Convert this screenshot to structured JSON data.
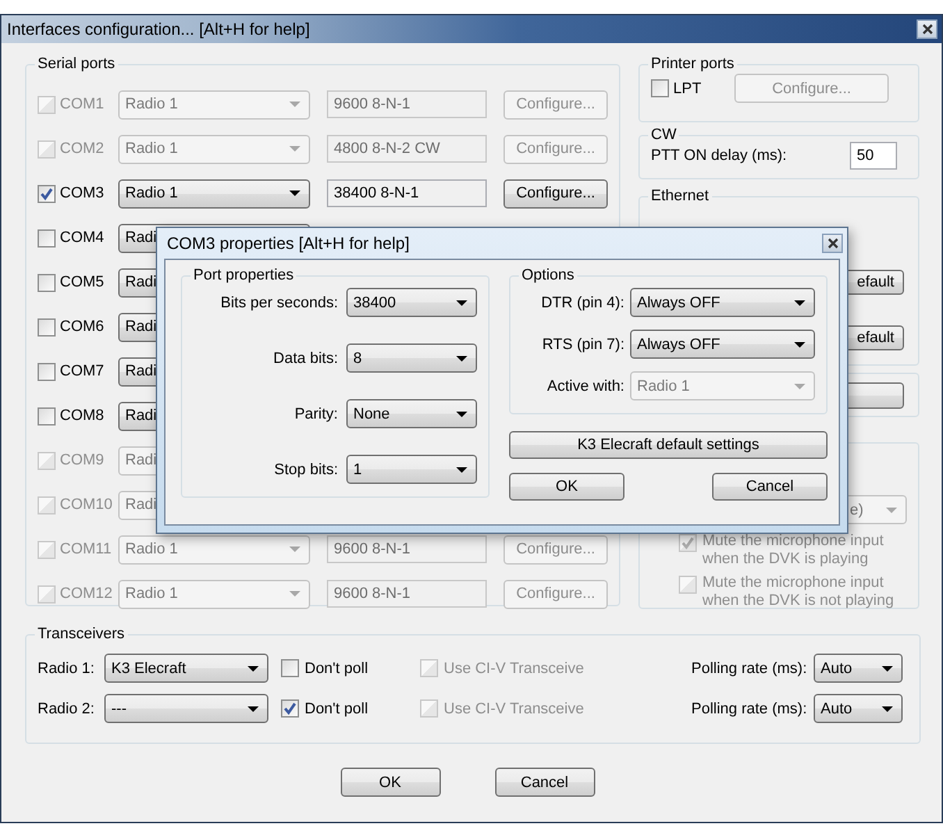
{
  "window": {
    "title": "Interfaces configuration... [Alt+H for help]"
  },
  "serial_ports": {
    "title": "Serial ports",
    "ports": [
      {
        "label": "COM1",
        "checked": false,
        "disabled": true,
        "radio": "Radio 1",
        "settings": "9600 8-N-1",
        "button": "Configure..."
      },
      {
        "label": "COM2",
        "checked": false,
        "disabled": true,
        "radio": "Radio 1",
        "settings": "4800 8-N-2 CW",
        "button": "Configure..."
      },
      {
        "label": "COM3",
        "checked": true,
        "disabled": false,
        "radio": "Radio 1",
        "settings": "38400 8-N-1",
        "button": "Configure..."
      },
      {
        "label": "COM4",
        "checked": false,
        "disabled": false,
        "radio": "Radi"
      },
      {
        "label": "COM5",
        "checked": false,
        "disabled": false,
        "radio": "Radi"
      },
      {
        "label": "COM6",
        "checked": false,
        "disabled": false,
        "radio": "Radi"
      },
      {
        "label": "COM7",
        "checked": false,
        "disabled": false,
        "radio": "Radi"
      },
      {
        "label": "COM8",
        "checked": false,
        "disabled": false,
        "radio": "Radi"
      },
      {
        "label": "COM9",
        "checked": false,
        "disabled": true,
        "radio": "Radi"
      },
      {
        "label": "COM10",
        "checked": false,
        "disabled": true,
        "radio": "Radi"
      },
      {
        "label": "COM11",
        "checked": false,
        "disabled": true,
        "radio": "Radio 1",
        "settings": "9600 8-N-1",
        "button": "Configure..."
      },
      {
        "label": "COM12",
        "checked": false,
        "disabled": true,
        "radio": "Radio 1",
        "settings": "9600 8-N-1",
        "button": "Configure..."
      }
    ]
  },
  "printer_ports": {
    "title": "Printer ports",
    "lpt": {
      "label": "LPT",
      "checked": false
    },
    "configure": {
      "label": "Configure...",
      "disabled": true
    }
  },
  "cw": {
    "title": "CW",
    "label": "PTT ON delay (ms):",
    "value": "50"
  },
  "ethernet": {
    "title": "Ethernet",
    "buttons": [
      "efault",
      "efault"
    ]
  },
  "dvk": {
    "dropdown": {
      "value": "e)",
      "disabled": true
    },
    "checkboxes": [
      {
        "label": "Mute the microphone input when the DVK is playing",
        "checked": true,
        "disabled": true
      },
      {
        "label": "Mute the microphone input when the DVK is not playing",
        "checked": false,
        "disabled": true
      }
    ]
  },
  "transceivers": {
    "title": "Transceivers",
    "radios": [
      {
        "label": "Radio 1:",
        "value": "K3 Elecraft",
        "dont_poll": {
          "label": "Don't poll",
          "checked": false
        },
        "civ": {
          "label": "Use CI-V Transceive",
          "checked": false,
          "disabled": true
        },
        "polling_label": "Polling rate (ms):",
        "polling": "Auto"
      },
      {
        "label": "Radio 2:",
        "value": "---",
        "dont_poll": {
          "label": "Don't poll",
          "checked": true
        },
        "civ": {
          "label": "Use CI-V Transceive",
          "checked": false,
          "disabled": true
        },
        "polling_label": "Polling rate (ms):",
        "polling": "Auto"
      }
    ]
  },
  "buttons": [
    "OK",
    "Cancel"
  ],
  "dialog": {
    "title": "COM3 properties [Alt+H for help]",
    "port_properties": {
      "title": "Port properties",
      "fields": [
        {
          "label": "Bits per seconds:",
          "value": "38400"
        },
        {
          "label": "Data bits:",
          "value": "8"
        },
        {
          "label": "Parity:",
          "value": "None"
        },
        {
          "label": "Stop bits:",
          "value": "1"
        }
      ]
    },
    "options": {
      "title": "Options",
      "fields": [
        {
          "label": "DTR (pin 4):",
          "value": "Always OFF",
          "disabled": false
        },
        {
          "label": "RTS (pin 7):",
          "value": "Always OFF",
          "disabled": false
        },
        {
          "label": "Active with:",
          "value": "Radio 1",
          "disabled": true
        }
      ]
    },
    "preset_button": "K3 Elecraft default settings",
    "buttons": [
      "OK",
      "Cancel"
    ]
  }
}
